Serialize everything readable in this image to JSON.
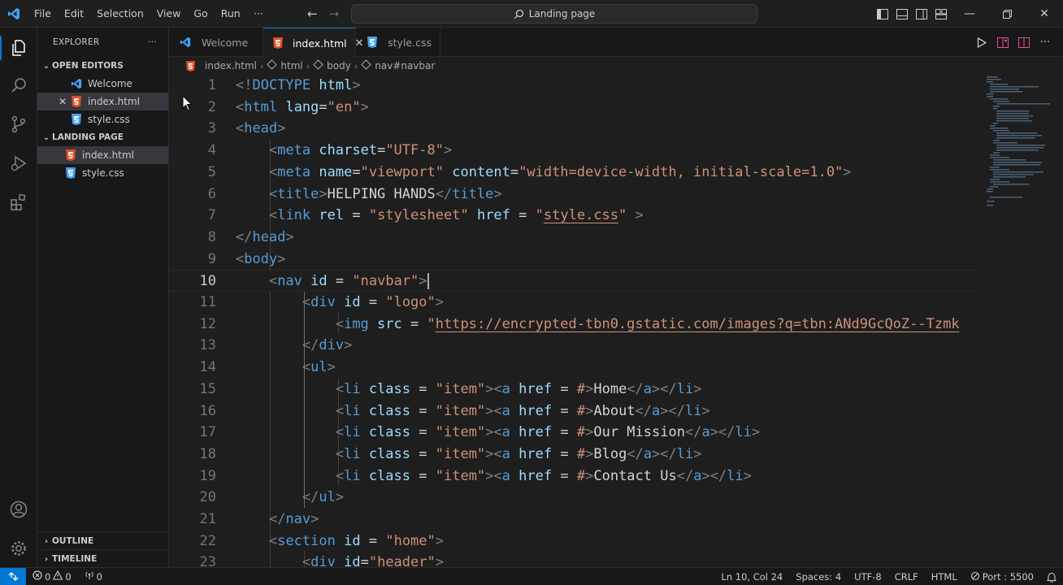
{
  "titlebar": {
    "menu": [
      "File",
      "Edit",
      "Selection",
      "View",
      "Go",
      "Run",
      "···"
    ],
    "search_text": "Landing page"
  },
  "sidebar": {
    "title": "EXPLORER",
    "more": "···",
    "open_editors_label": "OPEN EDITORS",
    "open_editors": [
      {
        "label": "Welcome",
        "icon": "vscode-icon"
      },
      {
        "label": "index.html",
        "icon": "html-icon"
      },
      {
        "label": "style.css",
        "icon": "css-icon"
      }
    ],
    "folder_label": "LANDING PAGE",
    "files": [
      {
        "label": "index.html",
        "icon": "html-icon"
      },
      {
        "label": "style.css",
        "icon": "css-icon"
      }
    ],
    "outline_label": "OUTLINE",
    "timeline_label": "TIMELINE"
  },
  "tabs": [
    {
      "label": "Welcome",
      "icon": "vscode-icon"
    },
    {
      "label": "index.html",
      "icon": "html-icon",
      "active": true
    },
    {
      "label": "style.css",
      "icon": "css-icon"
    }
  ],
  "breadcrumb": [
    "index.html",
    "html",
    "body",
    "nav#navbar"
  ],
  "editor": {
    "line_numbers": [
      "1",
      "2",
      "3",
      "4",
      "5",
      "6",
      "7",
      "8",
      "9",
      "10",
      "11",
      "12",
      "13",
      "14",
      "15",
      "16",
      "17",
      "18",
      "19",
      "20",
      "21",
      "22",
      "23"
    ],
    "current_line": "10"
  },
  "statusbar": {
    "errors": "0",
    "warnings": "0",
    "ports": "0",
    "position": "Ln 10, Col 24",
    "spaces": "Spaces: 4",
    "encoding": "UTF-8",
    "eol": "CRLF",
    "language": "HTML",
    "port": "Port : 5500"
  },
  "colors": {
    "accent": "#0078d4",
    "tag": "#569cd6",
    "attribute": "#9cdcfe",
    "string": "#ce9178",
    "bracket": "#808080",
    "html_icon": "#e44d26",
    "css_icon": "#42a5f5"
  }
}
